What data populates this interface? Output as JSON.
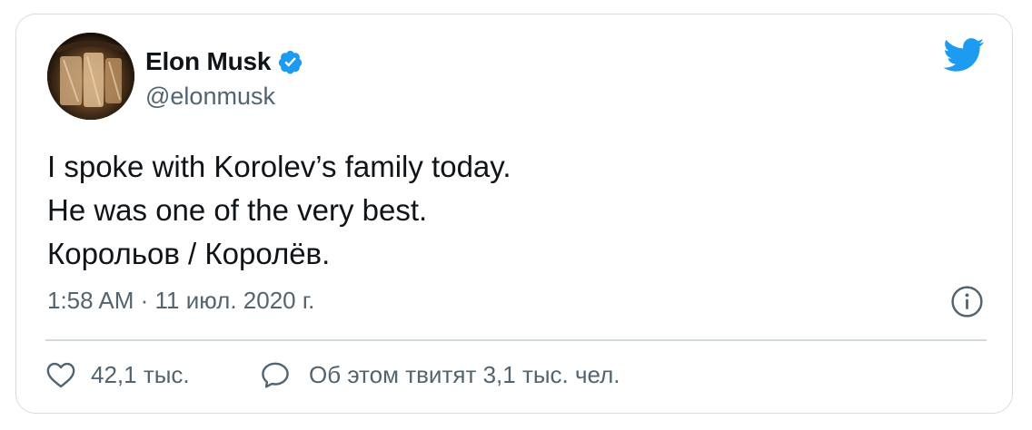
{
  "author": {
    "name": "Elon Musk",
    "handle": "@elonmusk",
    "verified": true,
    "avatar_icon": "avatar-photo"
  },
  "tweet": {
    "lines": [
      "I spoke with Korolev’s family today.",
      "He was one of the very best.",
      "Корольов / Королёв."
    ],
    "timestamp": "1:58 AM · 11 июл. 2020 г."
  },
  "actions": {
    "likes_icon": "heart-icon",
    "likes_count": "42,1 тыс.",
    "reply_icon": "speech-bubble-icon",
    "reply_text": "Об этом твитят 3,1 тыс. чел."
  },
  "icons": {
    "brand": "twitter-bird-icon",
    "info": "info-icon",
    "verified": "verified-badge-icon"
  },
  "colors": {
    "brand_blue": "#1d9bf0",
    "text_primary": "#0f1419",
    "text_secondary": "#536471",
    "border": "#d6dde3"
  }
}
